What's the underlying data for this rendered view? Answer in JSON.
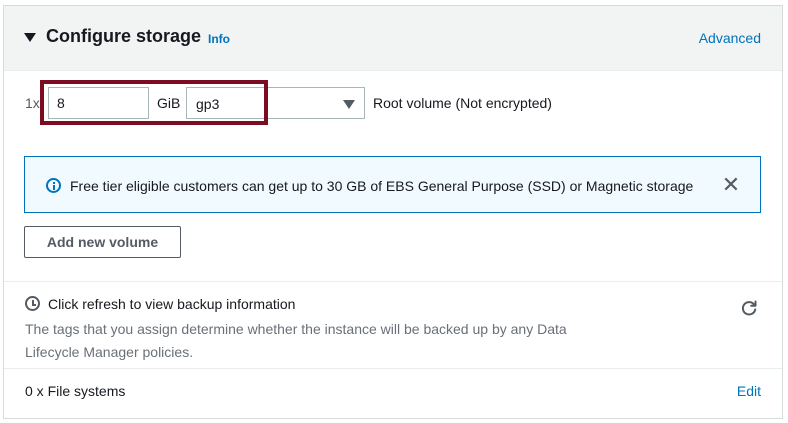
{
  "header": {
    "title": "Configure storage",
    "info_label": "Info",
    "advanced_label": "Advanced"
  },
  "volume": {
    "count_label": "1x",
    "size_value": "8",
    "size_unit": "GiB",
    "type_value": "gp3",
    "description": "Root volume  (Not encrypted)"
  },
  "alert": {
    "message": "Free tier eligible customers can get up to 30 GB of EBS General Purpose (SSD) or Magnetic storage",
    "close_symbol": "✕"
  },
  "add_volume_label": "Add new volume",
  "backup": {
    "title": "Click refresh to view backup information",
    "description": "The tags that you assign determine whether the instance will be backed up by any Data Lifecycle Manager policies."
  },
  "file_systems": {
    "label": "0 x File systems",
    "edit_label": "Edit"
  },
  "colors": {
    "link": "#0073bb",
    "highlight": "#7b0c22",
    "alert_bg": "#f1faff",
    "header_bg": "#f2f3f3"
  },
  "icons": [
    "caret-down-icon",
    "info-icon",
    "close-icon",
    "clock-icon",
    "refresh-icon"
  ]
}
